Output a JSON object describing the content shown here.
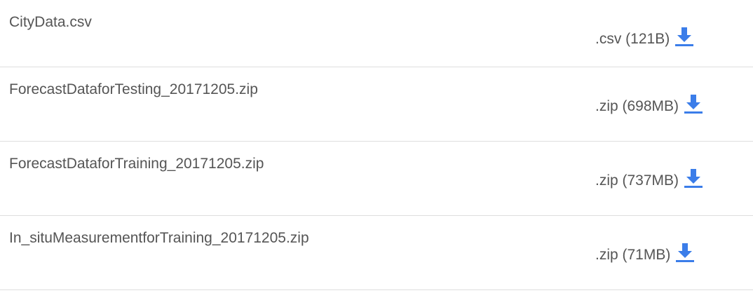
{
  "files": [
    {
      "name": "CityData.csv",
      "size": ".csv (121B)",
      "icon": "download-icon"
    },
    {
      "name": "ForecastDataforTesting_20171205.zip",
      "size": ".zip (698MB)",
      "icon": "download-icon"
    },
    {
      "name": "ForecastDataforTraining_20171205.zip",
      "size": ".zip (737MB)",
      "icon": "download-icon"
    },
    {
      "name": "In_situMeasurementforTraining_20171205.zip",
      "size": ".zip (71MB)",
      "icon": "download-icon"
    }
  ],
  "colors": {
    "text": "#555555",
    "accent": "#3b7de9",
    "divider": "#dedede"
  }
}
